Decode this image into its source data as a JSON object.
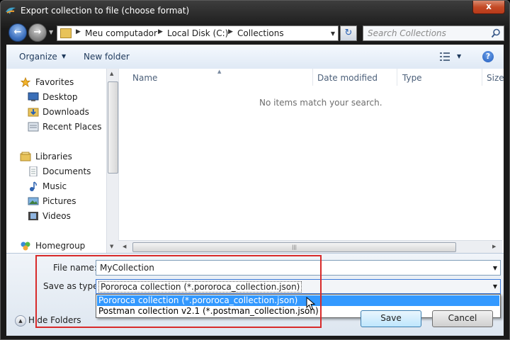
{
  "window": {
    "title": "Export collection to file (choose format)",
    "close_label": "x"
  },
  "nav": {
    "breadcrumbs": [
      "Meu computador",
      "Local Disk (C:)",
      "Collections"
    ],
    "search_placeholder": "Search Collections"
  },
  "toolbar": {
    "organize_label": "Organize",
    "new_folder_label": "New folder",
    "help_label": "?"
  },
  "sidebar": {
    "items": [
      {
        "label": "Favorites",
        "icon": "star-icon"
      },
      {
        "label": "Desktop",
        "icon": "desktop-icon"
      },
      {
        "label": "Downloads",
        "icon": "downloads-folder-icon"
      },
      {
        "label": "Recent Places",
        "icon": "recent-places-icon"
      },
      {
        "label": "Libraries",
        "icon": "libraries-icon"
      },
      {
        "label": "Documents",
        "icon": "documents-icon"
      },
      {
        "label": "Music",
        "icon": "music-icon"
      },
      {
        "label": "Pictures",
        "icon": "pictures-icon"
      },
      {
        "label": "Videos",
        "icon": "videos-icon"
      },
      {
        "label": "Homegroup",
        "icon": "homegroup-icon"
      }
    ]
  },
  "file_list": {
    "columns": [
      "Name",
      "Date modified",
      "Type",
      "Size"
    ],
    "empty_message": "No items match your search."
  },
  "form": {
    "file_name_label": "File name:",
    "file_name_value": "MyCollection",
    "save_as_type_label": "Save as type:",
    "save_as_type_value": "Pororoca collection (*.pororoca_collection.json)",
    "save_as_type_options": [
      "Pororoca collection (*.pororoca_collection.json)",
      "Postman collection v2.1 (*.postman_collection.json)"
    ]
  },
  "footer": {
    "hide_folders_label": "Hide Folders",
    "save_label": "Save",
    "cancel_label": "Cancel"
  },
  "colors": {
    "highlight": "#d82a2a",
    "selection": "#3399ff",
    "close_button": "#c44a26"
  }
}
